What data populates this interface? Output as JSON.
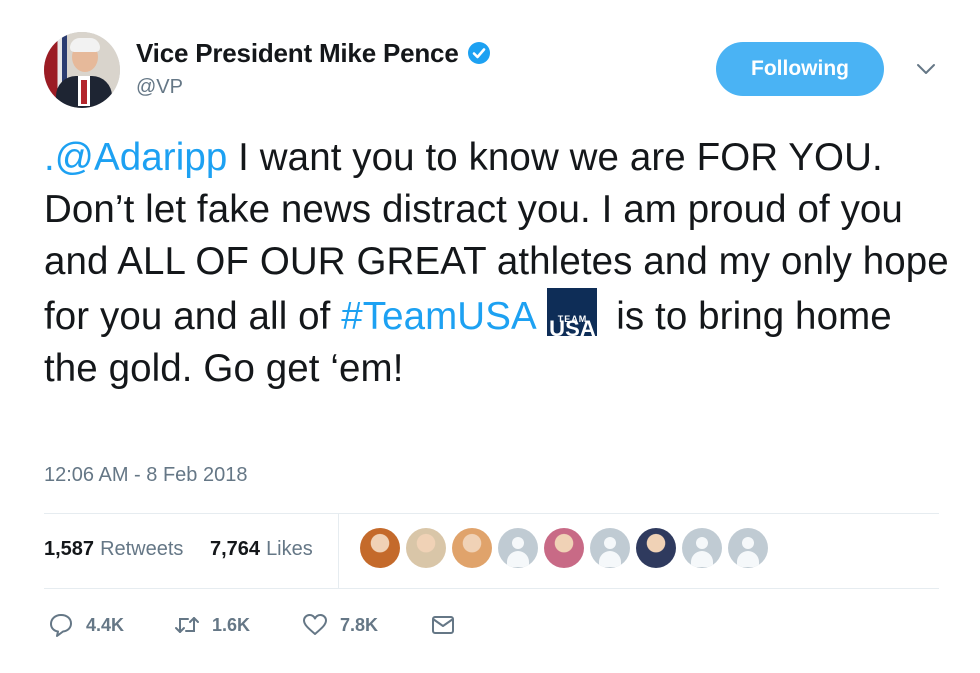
{
  "author": {
    "name": "Vice President Mike Pence",
    "handle": "@VP",
    "verified": true,
    "avatar_icon": "profile-photo"
  },
  "follow_button": {
    "label": "Following"
  },
  "menu_icon": "chevron-down-icon",
  "tweet": {
    "mention": ".@Adaripp",
    "text_part1": " I want you to know we are FOR YOU. Don’t let fake news distract you. I am proud of you and ALL OF OUR GREAT athletes and my only hope for you and all of ",
    "hashtag": "#TeamUSA",
    "emoji": {
      "line1": "TEAM",
      "line2": "USA"
    },
    "text_part2": " is to bring home the gold. Go get ‘em!"
  },
  "timestamp": "12:06 AM - 8 Feb 2018",
  "stats": {
    "retweets_count": "1,587",
    "retweets_label": "Retweets",
    "likes_count": "7,764",
    "likes_label": "Likes"
  },
  "likers": [
    {
      "type": "photo",
      "color": "#c46a2b"
    },
    {
      "type": "photo",
      "color": "#d9c6a8"
    },
    {
      "type": "photo",
      "color": "#e0a36b"
    },
    {
      "type": "default"
    },
    {
      "type": "photo",
      "color": "#c86a86"
    },
    {
      "type": "default"
    },
    {
      "type": "photo",
      "color": "#2f3a5e"
    },
    {
      "type": "default"
    },
    {
      "type": "default"
    }
  ],
  "actions": {
    "reply_count": "4.4K",
    "retweet_count": "1.6K",
    "like_count": "7.8K"
  },
  "colors": {
    "accent": "#1da1f2",
    "follow_bg": "#4ab3f4",
    "muted": "#657786",
    "divider": "#e6ecf0"
  }
}
